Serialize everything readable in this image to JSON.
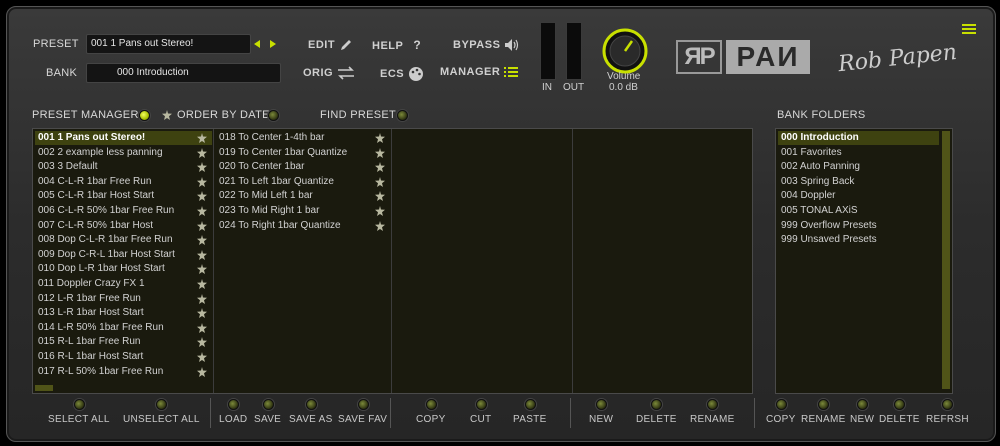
{
  "colors": {
    "accent": "#c8e000",
    "panel_bg": "#1a1a0e",
    "selected_row": "#3e4210"
  },
  "header": {
    "preset_label": "PRESET",
    "preset_value": "001 1 Pans out Stereo!",
    "bank_label": "BANK",
    "bank_value": "000 Introduction",
    "edit": "EDIT",
    "help": "HELP",
    "help_icon": "?",
    "bypass": "BYPASS",
    "orig": "ORIG",
    "ecs": "ECS",
    "manager": "MANAGER",
    "in": "IN",
    "out": "OUT",
    "volume_label": "Volume",
    "volume_value": "0.0 dB",
    "logo": "RP PAN",
    "signature": "Rob Papen"
  },
  "manager": {
    "title": "PRESET MANAGER",
    "order_by_date": "ORDER BY DATE",
    "find_preset": "FIND PRESET",
    "bank_folders": "BANK FOLDERS"
  },
  "presets_col1": [
    "001 1 Pans out Stereo!",
    "002 2 example less panning",
    "003 3 Default",
    "004 C-L-R 1bar Free Run",
    "005 C-L-R 1bar Host Start",
    "006 C-L-R 50% 1bar Free Run",
    "007 C-L-R 50% 1bar Host",
    "008 Dop C-L-R 1bar Free Run",
    "009 Dop C-R-L 1bar Host Start",
    "010 Dop L-R 1bar Host Start",
    "011 Doppler Crazy FX 1",
    "012 L-R 1bar Free Run",
    "013 L-R 1bar Host Start",
    "014 L-R 50% 1bar Free Run",
    "015 R-L 1bar Free Run",
    "016 R-L 1bar Host Start",
    "017 R-L 50% 1bar Free Run"
  ],
  "presets_col2": [
    "018 To Center 1-4th bar",
    "019 To Center 1bar Quantize",
    "020 To Center 1bar",
    "021 To Left 1bar Quantize",
    "022 To Mid Left 1 bar",
    "023 To Mid Right 1 bar",
    "024 To Right 1bar Quantize"
  ],
  "banks": [
    "000 Introduction",
    "001 Favorites",
    "002 Auto Panning",
    "003 Spring Back",
    "004 Doppler",
    "005 TONAL AXiS",
    "999 Overflow Presets",
    "999 Unsaved Presets"
  ],
  "buttons": {
    "select_all": "SELECT ALL",
    "unselect_all": "UNSELECT ALL",
    "load": "LOAD",
    "save": "SAVE",
    "save_as": "SAVE AS",
    "save_fav": "SAVE FAV",
    "copy": "COPY",
    "cut": "CUT",
    "paste": "PASTE",
    "new": "NEW",
    "delete": "DELETE",
    "rename": "RENAME",
    "bank_copy": "COPY",
    "bank_rename": "RENAME",
    "bank_new": "NEW",
    "bank_delete": "DELETE",
    "bank_refresh": "REFRSH"
  }
}
